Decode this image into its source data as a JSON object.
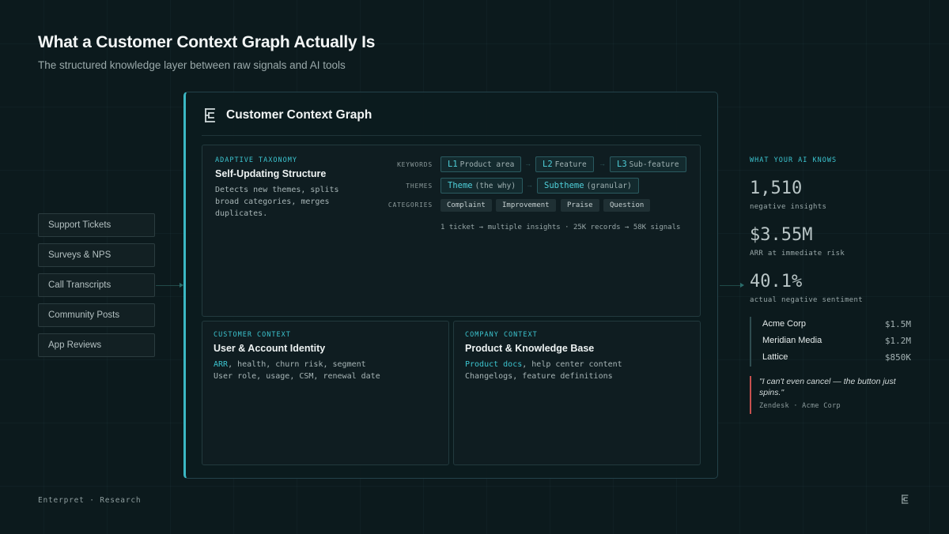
{
  "header": {
    "title": "What a Customer Context Graph Actually Is",
    "subtitle": "The structured knowledge layer between raw signals and AI tools"
  },
  "sources": [
    "Support Tickets",
    "Surveys & NPS",
    "Call Transcripts",
    "Community Posts",
    "App Reviews"
  ],
  "panel": {
    "logo_icon": "enterpret-e-icon",
    "title": "Customer Context Graph",
    "taxonomy": {
      "kicker": "ADAPTIVE TAXONOMY",
      "title": "Self-Updating Structure",
      "desc_lines": [
        "Detects new themes, splits",
        "broad categories, merges",
        "duplicates."
      ],
      "labels": {
        "keywords": "KEYWORDS",
        "themes": "THEMES",
        "categories": "CATEGORIES"
      },
      "keywords": [
        {
          "code": "L1",
          "name": "Product area"
        },
        {
          "code": "L2",
          "name": "Feature"
        },
        {
          "code": "L3",
          "name": "Sub-feature"
        }
      ],
      "themes": [
        {
          "code": "Theme",
          "name": "(the why)"
        },
        {
          "code": "Subtheme",
          "name": "(granular)"
        }
      ],
      "categories": [
        "Complaint",
        "Improvement",
        "Praise",
        "Question"
      ],
      "arrow": "→",
      "footer": "1 ticket → multiple insights · 25K records → 58K signals"
    },
    "customer": {
      "kicker": "CUSTOMER CONTEXT",
      "title": "User & Account Identity",
      "line1_hl": "ARR",
      "line1_rest": ", health, churn risk, segment",
      "line2": "User role, usage, CSM, renewal date"
    },
    "company": {
      "kicker": "COMPANY CONTEXT",
      "title": "Product & Knowledge Base",
      "line1_hl": "Product docs",
      "line1_rest": ", help center content",
      "line2": "Changelogs, feature definitions"
    }
  },
  "ai_knows": {
    "kicker": "WHAT YOUR AI KNOWS",
    "stats": [
      {
        "value": "1,510",
        "label": "negative insights"
      },
      {
        "value": "$3.55M",
        "label": "ARR at immediate risk"
      },
      {
        "value": "40.1%",
        "label": "actual negative sentiment"
      }
    ],
    "accounts": [
      {
        "name": "Acme Corp",
        "value": "$1.5M"
      },
      {
        "name": "Meridian Media",
        "value": "$1.2M"
      },
      {
        "name": "Lattice",
        "value": "$850K"
      }
    ],
    "quote": "\"I can't even cancel — the button just spins.\"",
    "quote_source": "Zendesk · Acme Corp"
  },
  "footer": {
    "text": "Enterpret · Research",
    "logo_icon": "enterpret-e-icon"
  },
  "colors": {
    "accent": "#3cc4cf",
    "background": "#0c1a1d",
    "quote_bar": "#c8514f"
  }
}
